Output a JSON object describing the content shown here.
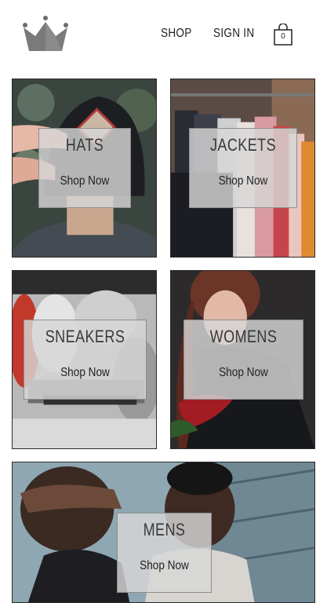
{
  "header": {
    "logo_icon": "crown-icon",
    "nav": [
      {
        "label": "SHOP"
      },
      {
        "label": "SIGN IN"
      }
    ],
    "cart": {
      "icon": "shopping-bag-icon",
      "count": "0"
    }
  },
  "categories": [
    {
      "title": "HATS",
      "cta": "Shop Now"
    },
    {
      "title": "JACKETS",
      "cta": "Shop Now"
    },
    {
      "title": "SNEAKERS",
      "cta": "Shop Now"
    },
    {
      "title": "WOMENS",
      "cta": "Shop Now"
    },
    {
      "title": "MENS",
      "cta": "Shop Now"
    }
  ]
}
